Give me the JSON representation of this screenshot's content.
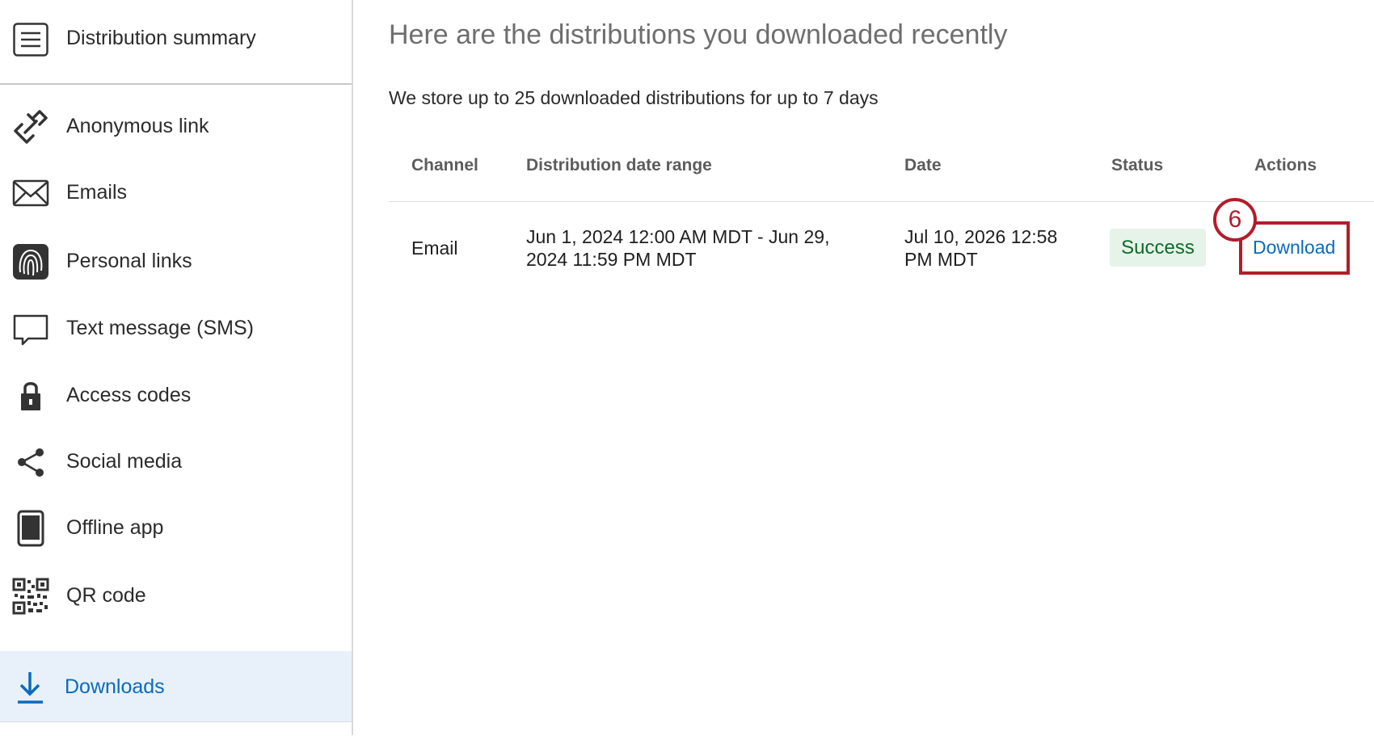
{
  "sidebar": {
    "summary_label": "Distribution summary",
    "items": [
      {
        "label": "Anonymous link",
        "icon": "link-icon"
      },
      {
        "label": "Emails",
        "icon": "envelope-icon"
      },
      {
        "label": "Personal links",
        "icon": "fingerprint-icon"
      },
      {
        "label": "Text message (SMS)",
        "icon": "chat-bubble-icon"
      },
      {
        "label": "Access codes",
        "icon": "lock-icon"
      },
      {
        "label": "Social media",
        "icon": "share-icon"
      },
      {
        "label": "Offline app",
        "icon": "tablet-icon"
      },
      {
        "label": "QR code",
        "icon": "qr-code-icon"
      },
      {
        "label": "Downloads",
        "icon": "download-icon",
        "active": true
      }
    ]
  },
  "main": {
    "title": "Here are the distributions you downloaded recently",
    "subtitle": "We store up to 25 downloaded distributions for up to 7 days",
    "columns": [
      "Channel",
      "Distribution date range",
      "Date",
      "Status",
      "Actions"
    ],
    "rows": [
      {
        "channel": "Email",
        "date_range_line1": "Jun 1, 2024 12:00 AM MDT - Jun 29,",
        "date_range_line2": "2024 11:59 PM MDT",
        "date_line1": "Jul 10, 2026 12:58",
        "date_line2": "PM MDT",
        "status": "Success",
        "action": "Download"
      }
    ],
    "step_number": "6"
  },
  "colors": {
    "accent": "#0a6bbd",
    "active_bg": "#e8f0fa",
    "success_bg": "#e6f3e8",
    "success_text": "#0e6b2a",
    "annotation_red": "#b21d2b"
  }
}
